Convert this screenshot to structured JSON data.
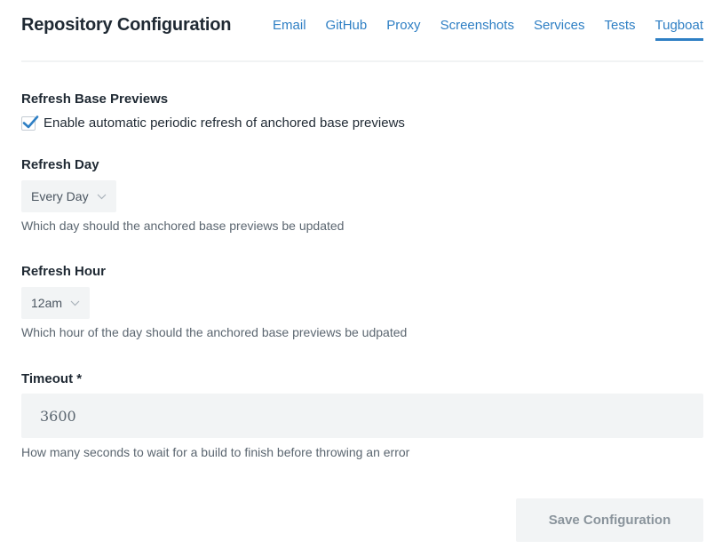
{
  "header": {
    "title": "Repository Configuration",
    "tabs": [
      {
        "label": "Email"
      },
      {
        "label": "GitHub"
      },
      {
        "label": "Proxy"
      },
      {
        "label": "Screenshots"
      },
      {
        "label": "Services"
      },
      {
        "label": "Tests"
      },
      {
        "label": "Tugboat",
        "active": true
      }
    ]
  },
  "refresh_base": {
    "label": "Refresh Base Previews",
    "checkbox_label": "Enable automatic periodic refresh of anchored base previews",
    "checked": true
  },
  "refresh_day": {
    "label": "Refresh Day",
    "value": "Every Day",
    "help": "Which day should the anchored base previews be updated"
  },
  "refresh_hour": {
    "label": "Refresh Hour",
    "value": "12am",
    "help": "Which hour of the day should the anchored base previews be udpated"
  },
  "timeout": {
    "label": "Timeout *",
    "value": "3600",
    "help": "How many seconds to wait for a build to finish before throwing an error"
  },
  "actions": {
    "save_label": "Save Configuration"
  },
  "colors": {
    "accent": "#2e7fc4",
    "field_bg": "#f2f4f5",
    "text": "#1f2933",
    "muted": "#5b6670"
  },
  "icons": {
    "checkbox": "checkmark-icon",
    "select": "chevron-down-icon"
  }
}
